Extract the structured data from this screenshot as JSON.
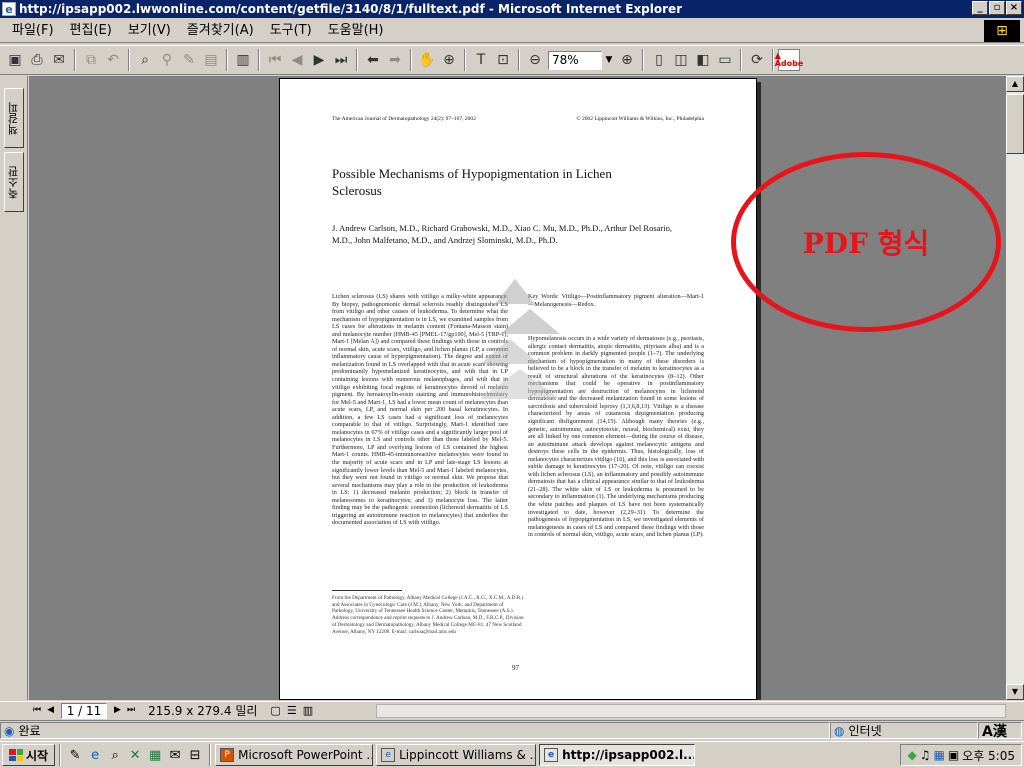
{
  "window": {
    "title": "http://ipsapp002.lwwonline.com/content/getfile/3140/8/1/fulltext.pdf - Microsoft Internet Explorer",
    "buttons": [
      "_",
      "▫",
      "×"
    ]
  },
  "menu": [
    "파일(F)",
    "편집(E)",
    "보기(V)",
    "즐겨찾기(A)",
    "도구(T)",
    "도움말(H)"
  ],
  "toolbar": {
    "zoom": "78%"
  },
  "left_tabs": [
    "책갈피",
    "축소판"
  ],
  "pdf": {
    "journal": "The American Journal of Dermatopathology 24(2): 97–107, 2002",
    "copyright": "© 2002 Lippincott Williams & Wilkins, Inc., Philadelphia",
    "title": "Possible Mechanisms of Hypopigmentation in Lichen Sclerosus",
    "authors": "J. Andrew Carlson, M.D., Richard Grabowski, M.D., Xiao C. Mu, M.D., Ph.D., Arthur Del Rosario, M.D., John Malfetano, M.D., and Andrzej Slominski, M.D., Ph.D.",
    "abstract": "Lichen sclerosus (LS) shares with vitiligo a milky-white appearance. By biopsy, pathognomonic dermal sclerosis readily distinguishes LS from vitiligo and other causes of leukoderma. To determine what the mechanism of hypopigmentation is in LS, we examined samples from LS cases for alterations in melanin content (Fontana-Masson stain) and melanocyte number (HMB-45 [PMEL-17/gp100], Mel-5 [TRP-1], Mart-1 [Melan A]) and compared these findings with those in controls of normal skin, acute scars, vitiligo, and lichen planus (LP, a common inflammatory cause of hyperpigmentation). The degree and extent of melanization found in LS overlapped with that in acute scars showing predominantly hypomelanized keratinocytes, and with that in LP containing lesions with numerous melanophages, and with that in vitiligo exhibiting focal regions of keratinocytes devoid of melanin pigment. By hematoxylin-eosin staining and immunohistochemistry for Mel-5 and Mart-1, LS had a lower mean count of melanocytes than acute scars, LP, and normal skin per 200 basal keratinocytes. In addition, a few LS cases had a significant loss of melanocytes comparable to that of vitiligo. Surprisingly, Mart-1 identified rare melanocytes in 67% of vitiligo cases and a significantly larger pool of melanocytes in LS and controls other than those labeled by Mel-5. Furthermore, LP and overlying lesions of LS contained the highest Mart-1 counts. HMB-45-immunoreactive melanocytes were found in the majority of acute scars and in LP and late-stage LS lesions at significantly lower levels than Mel-5 and Mart-1 labeled melanocytes, but they were not found in vitiligo or normal skin. We propose that several mechanisms may play a role in the production of leukoderma in LS: 1) decreased melanin production; 2) block in transfer of melanosomes to keratinocytes; and 3) melanocyte loss. The latter finding may be the pathogenic connection (lichenoid dermatitis of LS triggering an autoimmune reaction to melanocytes) that underlies the documented association of LS with vitiligo.",
    "keywords": "Key Words: Vitiligo—Postinflammatory pigment alteration—Mart-1—Melanogenesis—Redox.",
    "body": "Hypomelanosis occurs in a wide variety of dermatoses (e.g., psoriasis, allergic contact dermatitis, atopic dermatitis, pityriasis alba) and is a common problem in darkly pigmented people (1–7). The underlying mechanism of hypopigmentation in many of these disorders is believed to be a block in the transfer of melanin to keratinocytes as a result of structural alterations of the keratinocytes (8–12). Other mechanisms that could be operative in postinflammatory hypopigmentation are destruction of melanocytes in lichenoid dermatoses and the decreased melanization found in some lesions of sarcoidosis and tuberculoid leprosy (1,3,6,8,13). Vitiligo is a disease characterized by areas of cutaneous depigmentation producing significant disfigurement (14,15). Although many theories (e.g., genetic, autoimmune, autocytotoxic, neural, biochemical) exist, they are all linked by one common element—during the course of disease, an autoimmune attack develops against melanocytic antigens and destroys these cells in the epidermis. Thus, histologically, loss of melanocytes characterizes vitiligo (16), and this loss is associated with subtle damage to keratinocytes (17–20). Of note, vitiligo can coexist with lichen sclerosus (LS), an inflammatory and possibly autoimmune dermatosis that has a clinical appearance similar to that of leukoderma (21–28). The white skin of LS or leukoderma is presumed to be secondary to inflammation (1). The underlying mechanisms producing the white patches and plaques of LS have not been systematically investigated to date, however (2,29–31). To determine the pathogenesis of hypopigmentation in LS, we investigated elements of melanogenesis in cases of LS and compared these findings with those in controls of normal skin, vitiligo, acute scars, and lichen planus (LP).",
    "footnote": "From the Department of Pathology, Albany Medical College (J.A.C., R.G., X.C.M., A.D.R.) and Associates in Gynecologic Care (J.M.), Albany, New York; and Department of Pathology, University of Tennessee Health Science Center, Memphis, Tennessee (A.S.). Address correspondence and reprint requests to J. Andrew Carlson, M.D., F.R.C.P., Division of Dermatology and Dermatopathology, Albany Medical College MC-81, 47 New Scotland Avenue, Albany, NY 12208. E-mail: carlsoa@mail.amc.edu",
    "page_number": "97"
  },
  "annotation": "PDF 형식",
  "nav": {
    "page": "1 / 11",
    "size": "215.9 x 279.4 밀리"
  },
  "status": {
    "text": "완료",
    "zone": "인터넷",
    "ime": "A漢"
  },
  "taskbar": {
    "start": "시작",
    "tasks": [
      {
        "label": "Microsoft PowerPoint ...",
        "active": false
      },
      {
        "label": "Lippincott Williams & ...",
        "active": false
      },
      {
        "label": "http://ipsapp002.l...",
        "active": true
      }
    ],
    "clock": "오후 5:05"
  }
}
